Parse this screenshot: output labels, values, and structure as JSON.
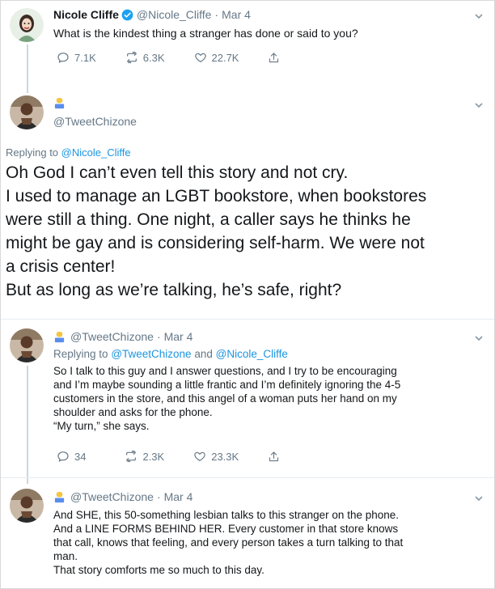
{
  "tweet1": {
    "name": "Nicole Cliffe",
    "handle": "@Nicole_Cliffe",
    "dot": "·",
    "date": "Mar 4",
    "text": "What is the kindest thing a stranger has done or said to you?",
    "replies": "7.1K",
    "retweets": "6.3K",
    "likes": "22.7K"
  },
  "tweet2": {
    "handle": "@TweetChizone",
    "replying_prefix": "Replying to",
    "replying_to": "@Nicole_Cliffe",
    "lines": [
      "Oh God I can’t even tell this story and not cry.",
      "I used to manage an LGBT bookstore, when bookstores",
      "were still a thing. One night, a caller says he thinks he",
      "might be gay and is considering self-harm. We were not",
      "a crisis center!",
      "But as long as we’re talking, he’s safe, right?"
    ]
  },
  "tweet3": {
    "handle": "@TweetChizone",
    "dot": "·",
    "date": "Mar 4",
    "replying_prefix": "Replying to",
    "replying_to_1": "@TweetChizone",
    "replying_and": "and",
    "replying_to_2": "@Nicole_Cliffe",
    "lines": [
      "So I talk to this guy and I answer questions, and I try to be encouraging",
      "and I’m maybe sounding a little frantic and I’m definitely ignoring the 4-5",
      "customers in the store, and this angel of a woman puts her hand on my",
      "shoulder and asks for the phone.",
      "“My turn,” she says."
    ],
    "replies": "34",
    "retweets": "2.3K",
    "likes": "23.3K"
  },
  "tweet4": {
    "handle": "@TweetChizone",
    "dot": "·",
    "date": "Mar 4",
    "lines": [
      "And SHE, this 50-something lesbian talks to this stranger on the phone.",
      "And a LINE FORMS BEHIND HER. Every customer in that store knows",
      "that call, knows that feeling, and every person takes a turn talking to that",
      "man.",
      "That story comforts me so much to this day."
    ]
  },
  "icons": {
    "reply": "reply-icon",
    "retweet": "retweet-icon",
    "like": "heart-icon",
    "share": "share-icon",
    "verified": "verified-badge-icon",
    "chevron": "chevron-down-icon",
    "badge": "emoji-badge-icon"
  },
  "colors": {
    "text": "#14171a",
    "muted": "#657786",
    "link": "#1b95e0",
    "verified": "#1da1f2",
    "thread": "#ccd6dd"
  }
}
